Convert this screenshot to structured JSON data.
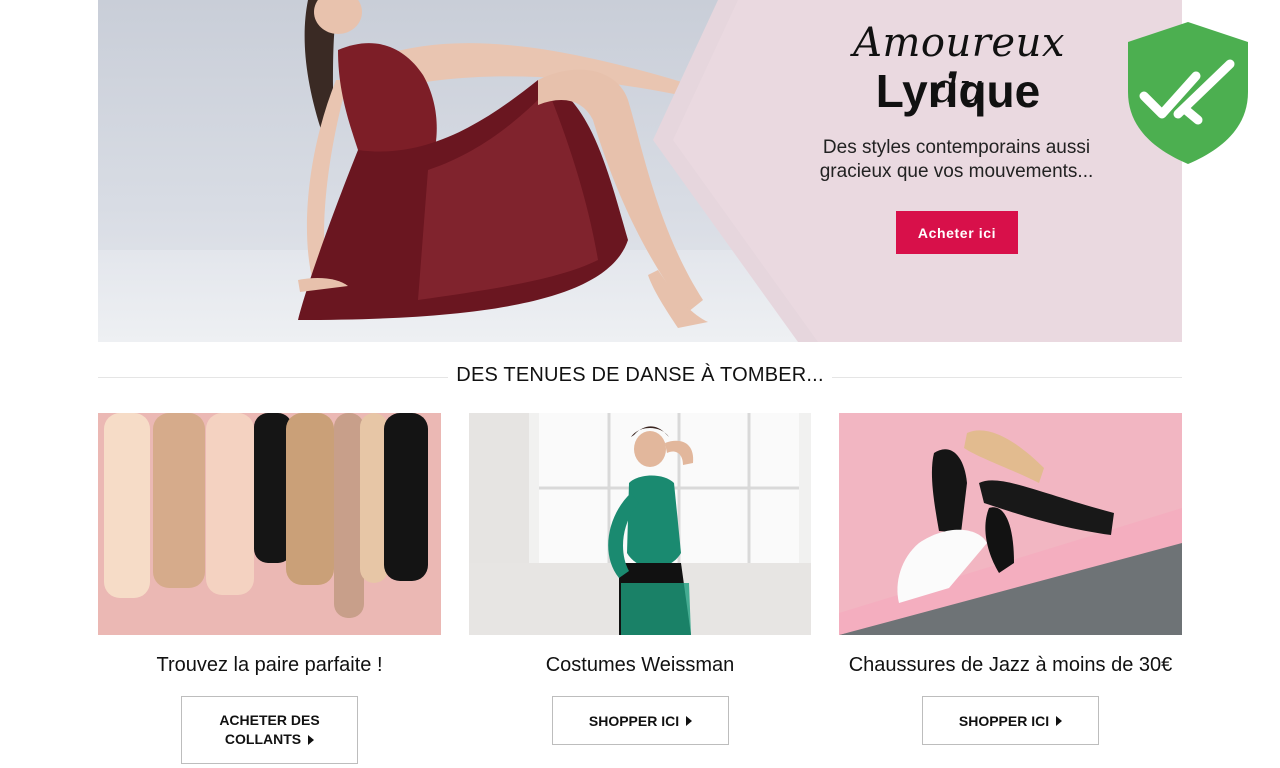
{
  "hero": {
    "script_title": "Amoureux du",
    "title": "Lyrique",
    "subtitle_line1": "Des styles contemporains aussi",
    "subtitle_line2": "gracieux que vos mouvements...",
    "cta_label": "Acheter ici",
    "cta_color": "#d8104a"
  },
  "security_badge": {
    "icon": "shield-check-icon",
    "color": "#4caf50"
  },
  "section": {
    "title": "DES TENUES DE DANSE À TOMBER..."
  },
  "cards": [
    {
      "caption": "Trouvez la paire parfaite !",
      "button_line1": "ACHETER DES",
      "button_line2": "COLLANTS",
      "image": "tights-photo"
    },
    {
      "caption": "Costumes Weissman",
      "button": "SHOPPER ICI",
      "image": "costume-photo"
    },
    {
      "caption": "Chaussures de Jazz à moins de 30€",
      "button": "SHOPPER ICI",
      "image": "jazz-shoes-photo"
    }
  ]
}
